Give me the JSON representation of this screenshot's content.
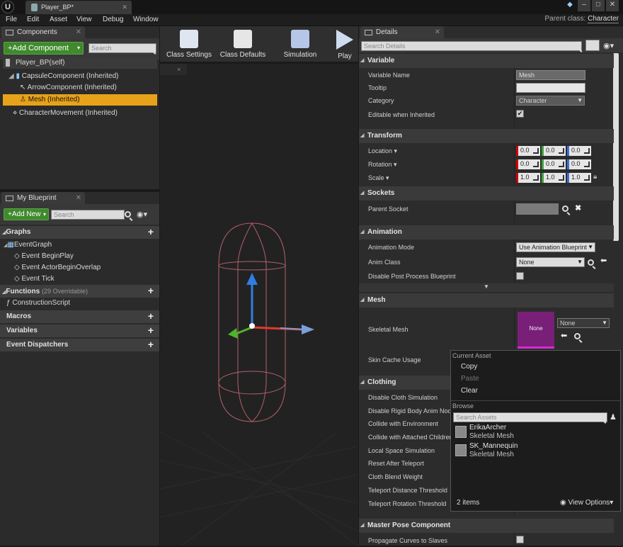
{
  "title_bar": {
    "tab_title": "Player_BP*"
  },
  "menu": [
    "File",
    "Edit",
    "Asset",
    "View",
    "Debug",
    "Window"
  ],
  "parent_class": {
    "label": "Parent class:",
    "value": "Character"
  },
  "components": {
    "tab": "Components",
    "add_button": "+Add Component",
    "search_placeholder": "Search",
    "self_item": "Player_BP(self)",
    "tree": [
      {
        "label": "CapsuleComponent (Inherited)"
      },
      {
        "label": "ArrowComponent (Inherited)"
      },
      {
        "label": "Mesh (Inherited)"
      },
      {
        "label": "CharacterMovement (Inherited)"
      }
    ]
  },
  "toolbar": {
    "class_settings": "Class Settings",
    "class_defaults": "Class Defaults",
    "simulation": "Simulation",
    "play": "Play"
  },
  "my_blueprint": {
    "tab": "My Blueprint",
    "add_new": "+Add New",
    "search_placeholder": "Search",
    "graphs_label": "Graphs",
    "event_graph": "EventGraph",
    "events": [
      "Event BeginPlay",
      "Event ActorBeginOverlap",
      "Event Tick"
    ],
    "functions_label": "Functions",
    "functions_count": "(29 Overridable)",
    "construction_script": "ConstructionScript",
    "macros": "Macros",
    "variables": "Variables",
    "event_dispatchers": "Event Dispatchers"
  },
  "details": {
    "tab": "Details",
    "search_placeholder": "Search Details",
    "variable": {
      "section": "Variable",
      "name_label": "Variable Name",
      "name_value": "Mesh",
      "tooltip_label": "Tooltip",
      "category_label": "Category",
      "category_value": "Character",
      "editable_label": "Editable when Inherited"
    },
    "transform": {
      "section": "Transform",
      "location": "Location",
      "rotation": "Rotation",
      "scale": "Scale",
      "location_values": [
        "0.0",
        "0.0",
        "0.0"
      ],
      "rotation_values": [
        "0.0",
        "0.0",
        "0.0"
      ],
      "scale_values": [
        "1.0",
        "1.0",
        "1.0"
      ]
    },
    "sockets": {
      "section": "Sockets",
      "parent_socket": "Parent Socket"
    },
    "animation": {
      "section": "Animation",
      "mode_label": "Animation Mode",
      "mode_value": "Use Animation Blueprint",
      "class_label": "Anim Class",
      "class_value": "None",
      "disable_pp_label": "Disable Post Process Blueprint"
    },
    "mesh": {
      "section": "Mesh",
      "skeletal_mesh_label": "Skeletal Mesh",
      "thumb_text": "None",
      "combo_value": "None",
      "skin_cache_label": "Skin Cache Usage"
    },
    "clothing": {
      "section": "Clothing",
      "rows": [
        "Disable Cloth Simulation",
        "Disable Rigid Body Anim Node",
        "Collide with Environment",
        "Collide with Attached Children",
        "Local Space Simulation",
        "Reset After Teleport",
        "Cloth Blend Weight",
        "Teleport Distance Threshold",
        "Teleport Rotation Threshold"
      ]
    },
    "master_pose": {
      "section": "Master Pose Component",
      "propagate": "Propagate Curves to Slaves"
    }
  },
  "popup": {
    "current_asset": "Current Asset",
    "copy": "Copy",
    "paste": "Paste",
    "clear": "Clear",
    "browse": "Browse",
    "search_placeholder": "Search Assets",
    "assets": [
      {
        "name": "ErikaArcher",
        "type": "Skeletal Mesh"
      },
      {
        "name": "SK_Mannequin",
        "type": "Skeletal Mesh"
      }
    ],
    "count": "2 items",
    "view_options": "View Options"
  }
}
